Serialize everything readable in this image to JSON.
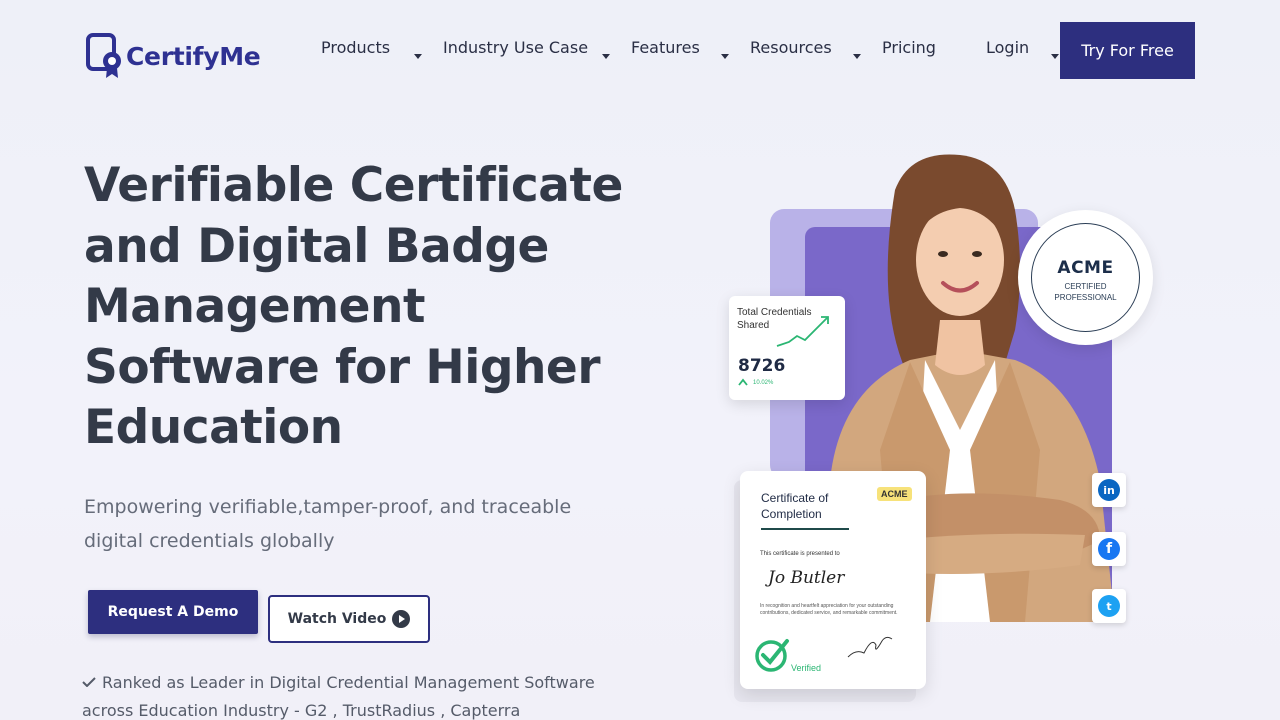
{
  "header": {
    "logo_text": "CertifyMe",
    "nav": [
      {
        "label": "Products"
      },
      {
        "label": "Industry Use Case"
      },
      {
        "label": "Features"
      },
      {
        "label": "Resources"
      },
      {
        "label": "Pricing"
      },
      {
        "label": "Login"
      }
    ],
    "cta_label": "Try For Free"
  },
  "hero": {
    "title": "Verifiable Certificate and Digital Badge Management Software for Higher Education",
    "subtitle": "Empowering verifiable,tamper-proof, and traceable digital credentials globally",
    "demo_button": "Request A Demo",
    "video_button": "Watch Video",
    "ranked_text": "Ranked as Leader in Digital Credential Management Software across Education Industry - G2 , TrustRadius , Capterra"
  },
  "stat_card": {
    "label": "Total Credentials Shared",
    "value": "8726",
    "change": "10.02%"
  },
  "badge": {
    "title": "ACME",
    "subtitle_line1": "CERTIFIED",
    "subtitle_line2": "PROFESSIONAL"
  },
  "certificate": {
    "title": "Certificate of Completion",
    "tag": "ACME",
    "presented": "This certificate is presented to",
    "recipient": "Jo Butler",
    "description": "In recognition and heartfelt appreciation for your outstanding contributions, dedicated service, and remarkable commitment.",
    "verified": "Verified"
  },
  "social": {
    "linkedin": "in",
    "facebook": "f",
    "twitter": "t"
  },
  "colors": {
    "brand": "#2d2f7f",
    "purple": "#7a68c9",
    "lavender": "#b9b2e8",
    "green": "#2bb673"
  },
  "icons": [
    "certifyme-logo-icon",
    "chevron-down-icon",
    "play-icon",
    "check-icon",
    "linkedin-icon",
    "facebook-icon",
    "twitter-icon",
    "verified-check-icon"
  ]
}
